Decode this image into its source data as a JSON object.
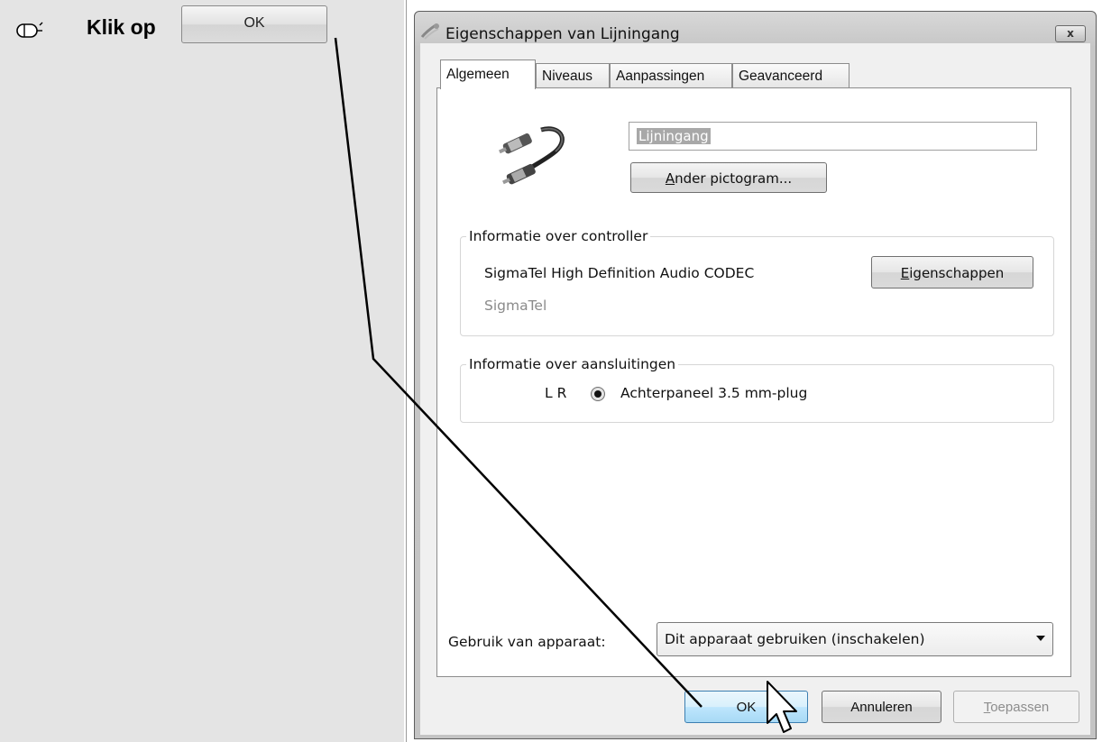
{
  "instruction": {
    "text": "Klik op",
    "button_label": "OK",
    "icon": "mouse-icon"
  },
  "dialog": {
    "title": "Eigenschappen van Lijningang",
    "close_label": "x",
    "tabs": [
      {
        "label": "Algemeen",
        "active": true
      },
      {
        "label": "Niveaus",
        "active": false
      },
      {
        "label": "Aanpassingen",
        "active": false
      },
      {
        "label": "Geavanceerd",
        "active": false
      }
    ],
    "general": {
      "device_icon": "audio-cable-icon",
      "name_value": "Lijningang",
      "change_icon_button": {
        "accel": "A",
        "rest": "nder pictogram..."
      },
      "controller": {
        "group_title": "Informatie over controller",
        "name": "SigmaTel High Definition Audio CODEC",
        "vendor": "SigmaTel",
        "properties_button": {
          "accel": "E",
          "rest": "igenschappen"
        }
      },
      "jacks": {
        "group_title": "Informatie over aansluitingen",
        "channels": "L R",
        "jack_label": "Achterpaneel 3.5 mm-plug"
      },
      "usage": {
        "label": "Gebruik van apparaat:",
        "selected": "Dit apparaat gebruiken (inschakelen)"
      }
    },
    "buttons": {
      "ok": "OK",
      "cancel": "Annuleren",
      "apply": {
        "accel": "T",
        "rest": "oepassen"
      }
    }
  },
  "colors": {
    "left_panel_bg": "#e4e4e4",
    "dialog_frame": "#c6c6c6",
    "ok_button_accent": "#bee6fd",
    "disabled_text": "#8d8d8d"
  }
}
